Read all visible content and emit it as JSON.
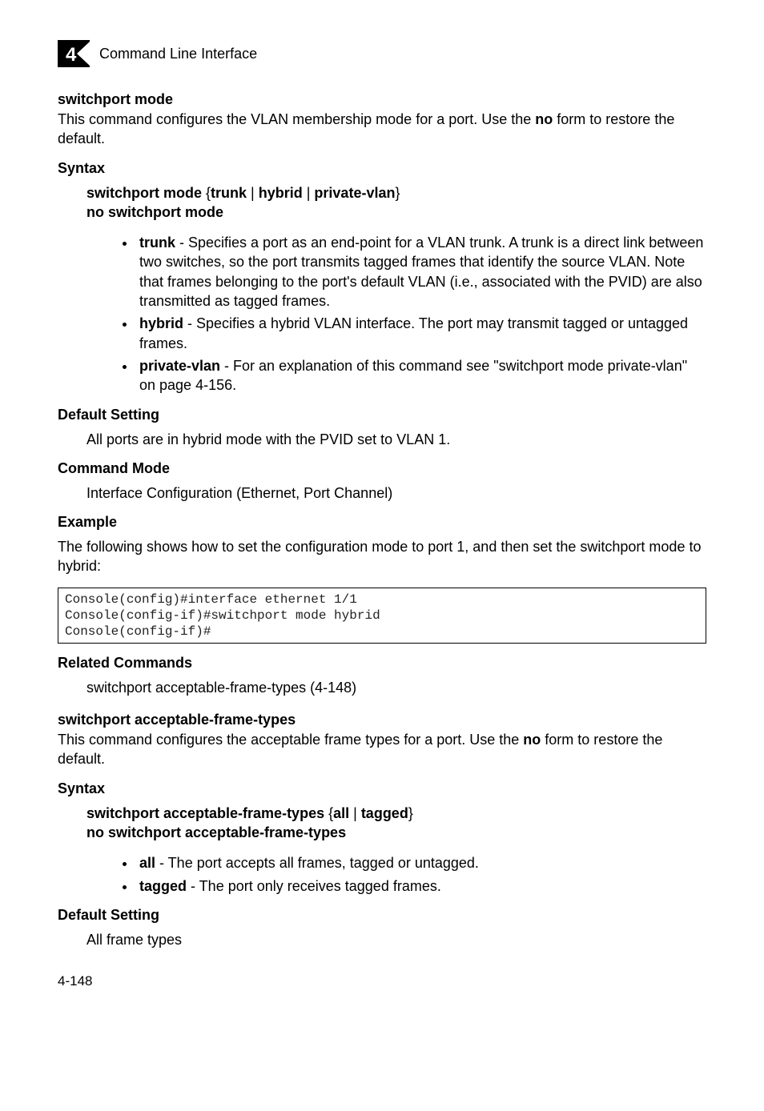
{
  "runhead": {
    "chapnum": "4",
    "title": "Command Line Interface"
  },
  "sec1": {
    "title": "switchport mode",
    "intro_pre": "This command configures the VLAN membership mode for a port. Use the ",
    "intro_bold": "no",
    "intro_post": " form to restore the default.",
    "syntax_label": "Syntax",
    "syntax_line1": {
      "p1": "switchport mode",
      "opt1": "trunk",
      "opt2": "hybrid",
      "opt3": "private-vlan"
    },
    "syntax_line2": "no switchport mode",
    "bullets": [
      {
        "b": "trunk",
        "t": " - Specifies a port as an end-point for a VLAN trunk. A trunk is a direct link between two switches, so the port transmits tagged frames that identify the source VLAN. Note that frames belonging to the port's default VLAN (i.e., associated with the PVID) are also transmitted as tagged frames."
      },
      {
        "b": "hybrid",
        "t": " - Specifies a hybrid VLAN interface. The port may transmit tagged or untagged frames."
      },
      {
        "b": "private-vlan",
        "t": " - For an explanation of this command see \"switchport mode private-vlan\" on page 4-156."
      }
    ],
    "default_label": "Default Setting",
    "default_text": "All ports are in hybrid mode with the PVID set to VLAN 1.",
    "cmdmode_label": "Command Mode",
    "cmdmode_text": "Interface Configuration (Ethernet, Port Channel)",
    "example_label": "Example",
    "example_intro": "The following shows how to set the configuration mode to port 1, and then set the switchport mode to hybrid:",
    "example_code": "Console(config)#interface ethernet 1/1\nConsole(config-if)#switchport mode hybrid\nConsole(config-if)#",
    "related_label": "Related Commands",
    "related_text": "switchport acceptable-frame-types (4-148)"
  },
  "sec2": {
    "title": "switchport acceptable-frame-types",
    "intro_pre": "This command configures the acceptable frame types for a port. Use the ",
    "intro_bold": "no",
    "intro_post": " form to restore the default.",
    "syntax_label": "Syntax",
    "syntax_line1": {
      "p1": "switchport acceptable-frame-types",
      "opt1": "all",
      "opt2": "tagged"
    },
    "syntax_line2": "no switchport acceptable-frame-types",
    "bullets": [
      {
        "b": "all",
        "t": " - The port accepts all frames, tagged or untagged."
      },
      {
        "b": "tagged",
        "t": " - The port only receives tagged frames."
      }
    ],
    "default_label": "Default Setting",
    "default_text": "All frame types"
  },
  "pagenum": "4-148"
}
